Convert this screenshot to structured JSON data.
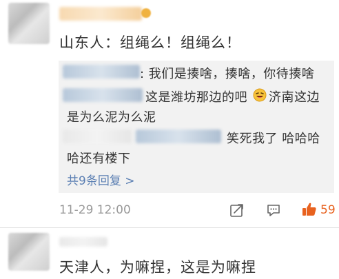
{
  "comment1": {
    "text": "山东人：组绳么！组绳么！",
    "replies": [
      {
        "line1": ": 我们是揍啥，揍啥，你待揍啥"
      },
      {
        "line1": "这是潍坊那边的吧",
        "emoji": "laughing-emoji",
        "line1b": "济南这边",
        "line2": "是为么泥为么泥"
      },
      {
        "line1": "笑死我了 哈哈哈",
        "line2": "哈还有楼下"
      }
    ],
    "more_replies": "共9条回复 >",
    "timestamp": "11-29 12:00",
    "likes": "59",
    "accent_color": "#e8621f",
    "link_color": "#5b7fb3"
  },
  "comment2": {
    "text": "天津人，为嘛捏，这是为嘛捏"
  }
}
